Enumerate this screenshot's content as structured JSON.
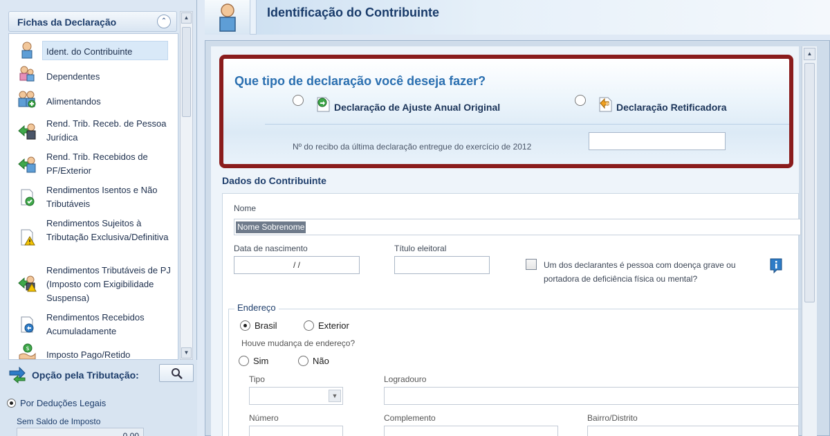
{
  "left_panel": {
    "fichas_title": "Fichas da Declaração",
    "items": [
      {
        "label": "Ident. do Contribuinte",
        "icon": "person-icon"
      },
      {
        "label": "Dependentes",
        "icon": "dependents-icon"
      },
      {
        "label": "Alimentandos",
        "icon": "alimentandos-icon"
      },
      {
        "label": "Rend. Trib. Receb. de Pessoa Jurídica",
        "icon": "income-pj-icon"
      },
      {
        "label": "Rend. Trib. Recebidos de PF/Exterior",
        "icon": "income-pf-icon"
      },
      {
        "label": "Rendimentos Isentos e Não Tributáveis",
        "icon": "exempt-income-icon"
      },
      {
        "label": "Rendimentos Sujeitos à Tributação Exclusiva/Definitiva",
        "icon": "warning-doc-icon"
      },
      {
        "label": "Rendimentos Tributáveis de PJ (Imposto com Exigibilidade Suspensa)",
        "icon": "suspended-tax-icon"
      },
      {
        "label": "Rendimentos Recebidos Acumuladamente",
        "icon": "accumulated-income-icon"
      },
      {
        "label": "Imposto Pago/Retido",
        "icon": "tax-paid-icon"
      }
    ],
    "opcao_title": "Opção pela Tributação:",
    "opcao_option": "Por Deduções Legais",
    "saldo_label": "Sem Saldo de Imposto",
    "saldo_value": "0,00"
  },
  "header": {
    "title": "Identificação do Contribuinte"
  },
  "declaracao": {
    "question": "Que tipo de declaração você deseja fazer?",
    "option_original": "Declaração de Ajuste Anual Original",
    "option_retificadora": "Declaração Retificadora",
    "recibo_label": "Nº do recibo da última declaração entregue do exercício de 2012"
  },
  "dados": {
    "title": "Dados do Contribuinte",
    "nome_label": "Nome",
    "nome_value": "Nome Sobrenome",
    "nascimento_label": "Data de nascimento",
    "nascimento_value": " /  /",
    "titulo_label": "Título eleitoral",
    "doenca_label": "Um dos declarantes é pessoa com doença grave ou portadora de deficiência física ou mental?",
    "endereco_legend": "Endereço",
    "brasil_label": "Brasil",
    "exterior_label": "Exterior",
    "mudanca_label": "Houve mudança de endereço?",
    "sim_label": "Sim",
    "nao_label": "Não",
    "tipo_label": "Tipo",
    "logradouro_label": "Logradouro",
    "numero_label": "Número",
    "complemento_label": "Complemento",
    "bairro_label": "Bairro/Distrito"
  },
  "colors": {
    "highlight_border": "#8a1c1c",
    "question_blue": "#2a6fb0",
    "title_navy": "#193b6a"
  }
}
